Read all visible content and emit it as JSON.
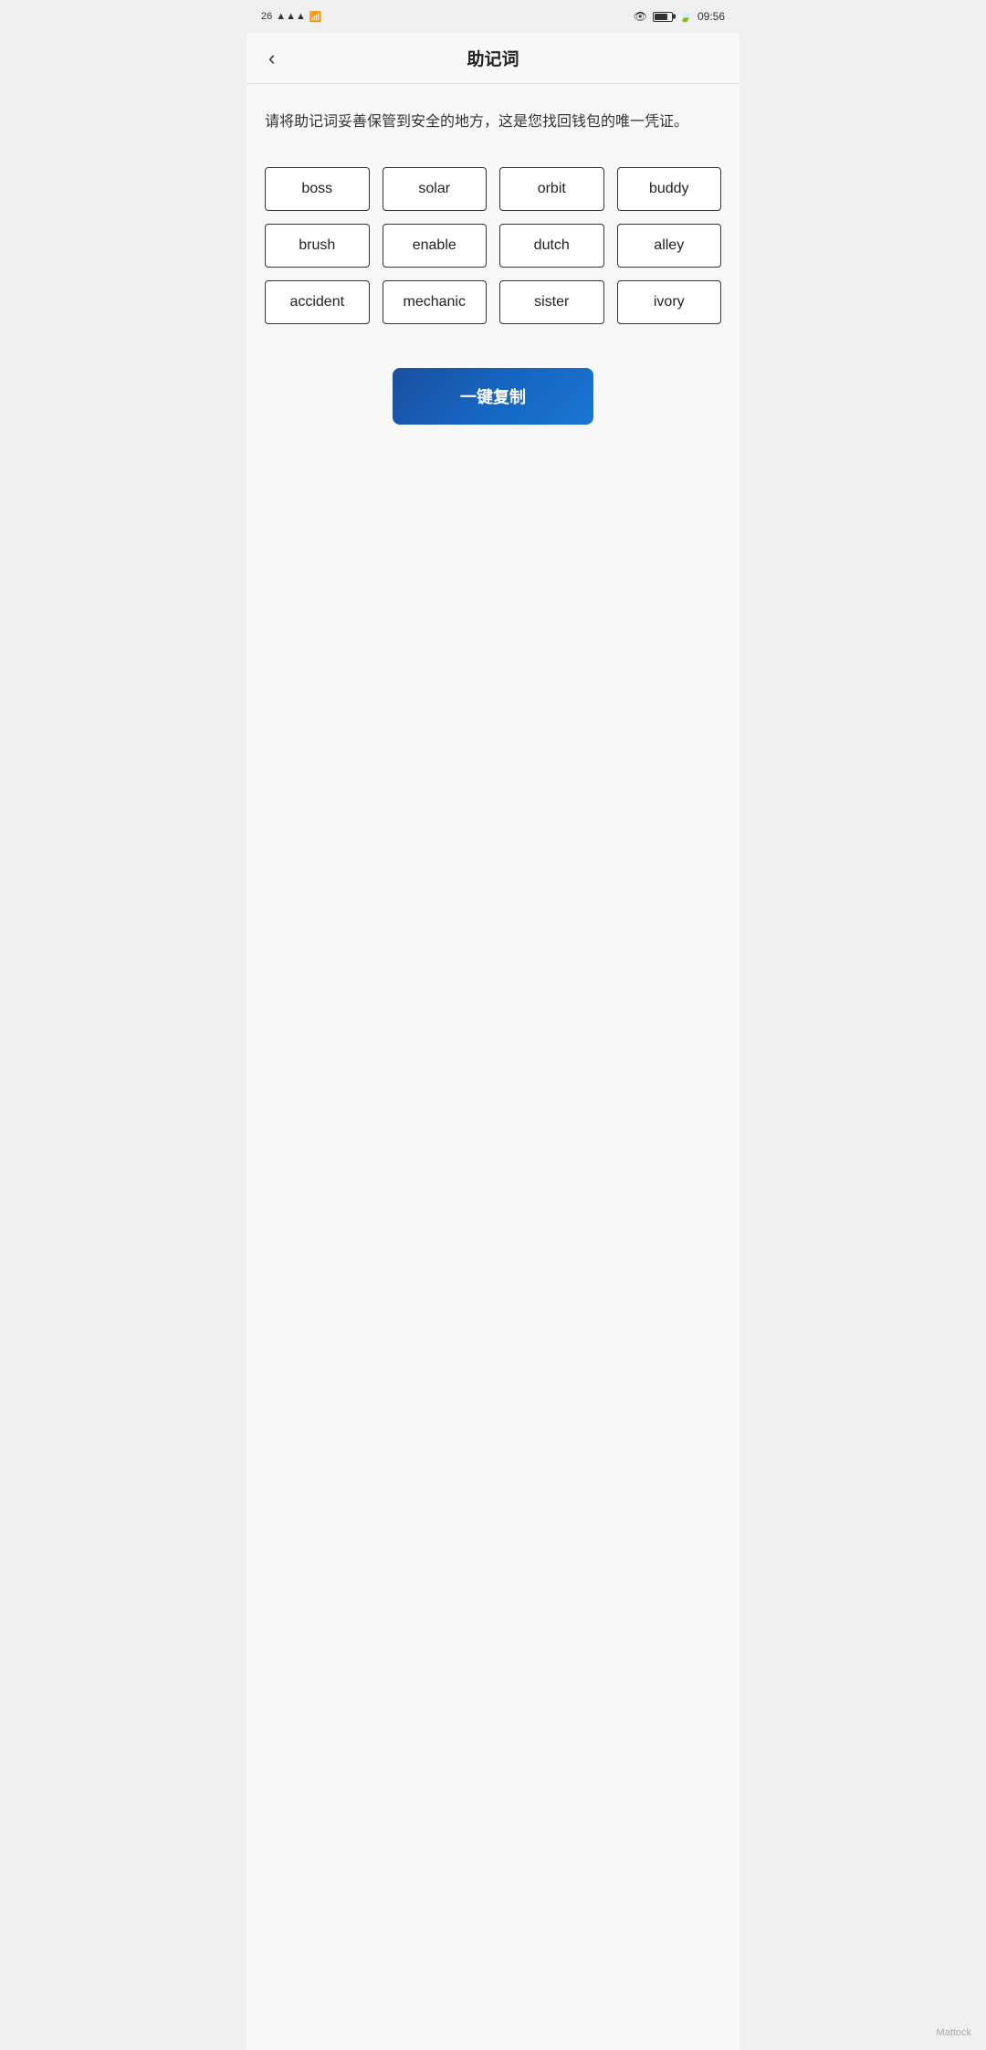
{
  "statusBar": {
    "network": "26",
    "time": "09:56",
    "battery": "76"
  },
  "header": {
    "back_label": "‹",
    "title": "助记词"
  },
  "description": "请将助记词妥善保管到安全的地方，这是您找回钱包的唯一凭证。",
  "words": [
    "boss",
    "solar",
    "orbit",
    "buddy",
    "brush",
    "enable",
    "dutch",
    "alley",
    "accident",
    "mechanic",
    "sister",
    "ivory"
  ],
  "copyButton": {
    "label": "一键复制"
  },
  "watermark": "Mattock"
}
